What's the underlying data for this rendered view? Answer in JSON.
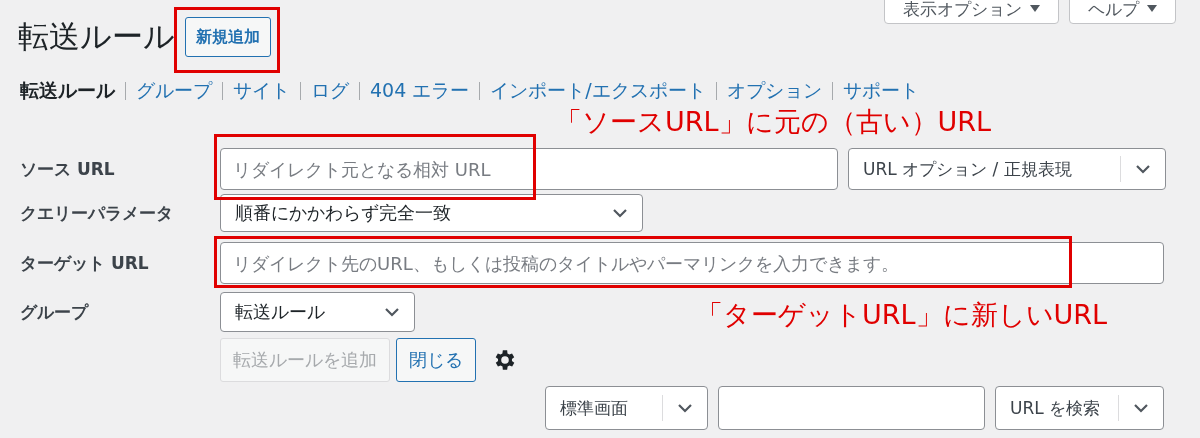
{
  "header_buttons": [
    {
      "label": "表示オプション"
    },
    {
      "label": "ヘルプ"
    }
  ],
  "title": "転送ルール",
  "add_new_button": {
    "label": "新規追加",
    "highlighted": true
  },
  "subnav": [
    {
      "label": "転送ルール",
      "selected": true
    },
    {
      "label": "グループ",
      "selected": false
    },
    {
      "label": "サイト",
      "selected": false
    },
    {
      "label": "ログ",
      "selected": false
    },
    {
      "label": "404 エラー",
      "selected": false
    },
    {
      "label": "インポート/エクスポート",
      "selected": false
    },
    {
      "label": "オプション",
      "selected": false
    },
    {
      "label": "サポート",
      "selected": false
    }
  ],
  "form": {
    "source_url": {
      "label": "ソース URL",
      "placeholder": "リダイレクト元となる相対 URL",
      "highlighted": true,
      "option_select": "URL オプション / 正規表現"
    },
    "query_parameter": {
      "label": "クエリーパラメータ",
      "value": "順番にかかわらず完全一致"
    },
    "target_url": {
      "label": "ターゲット URL",
      "placeholder": "リダイレクト先のURL、もしくは投稿のタイトルやパーマリンクを入力できます。",
      "highlighted": true
    },
    "group": {
      "label": "グループ",
      "value": "転送ルール"
    },
    "buttons": [
      {
        "label": "転送ルールを追加",
        "disabled": true
      },
      {
        "label": "閉じる",
        "disabled": false
      }
    ]
  },
  "bottom_bar": {
    "view_select": "標準画面",
    "search_select": "URL を検索"
  },
  "annotations": [
    {
      "text": "「ソースURL」に元の（古い）URL"
    },
    {
      "text": "「ターゲットURL」に新しいURL"
    }
  ]
}
